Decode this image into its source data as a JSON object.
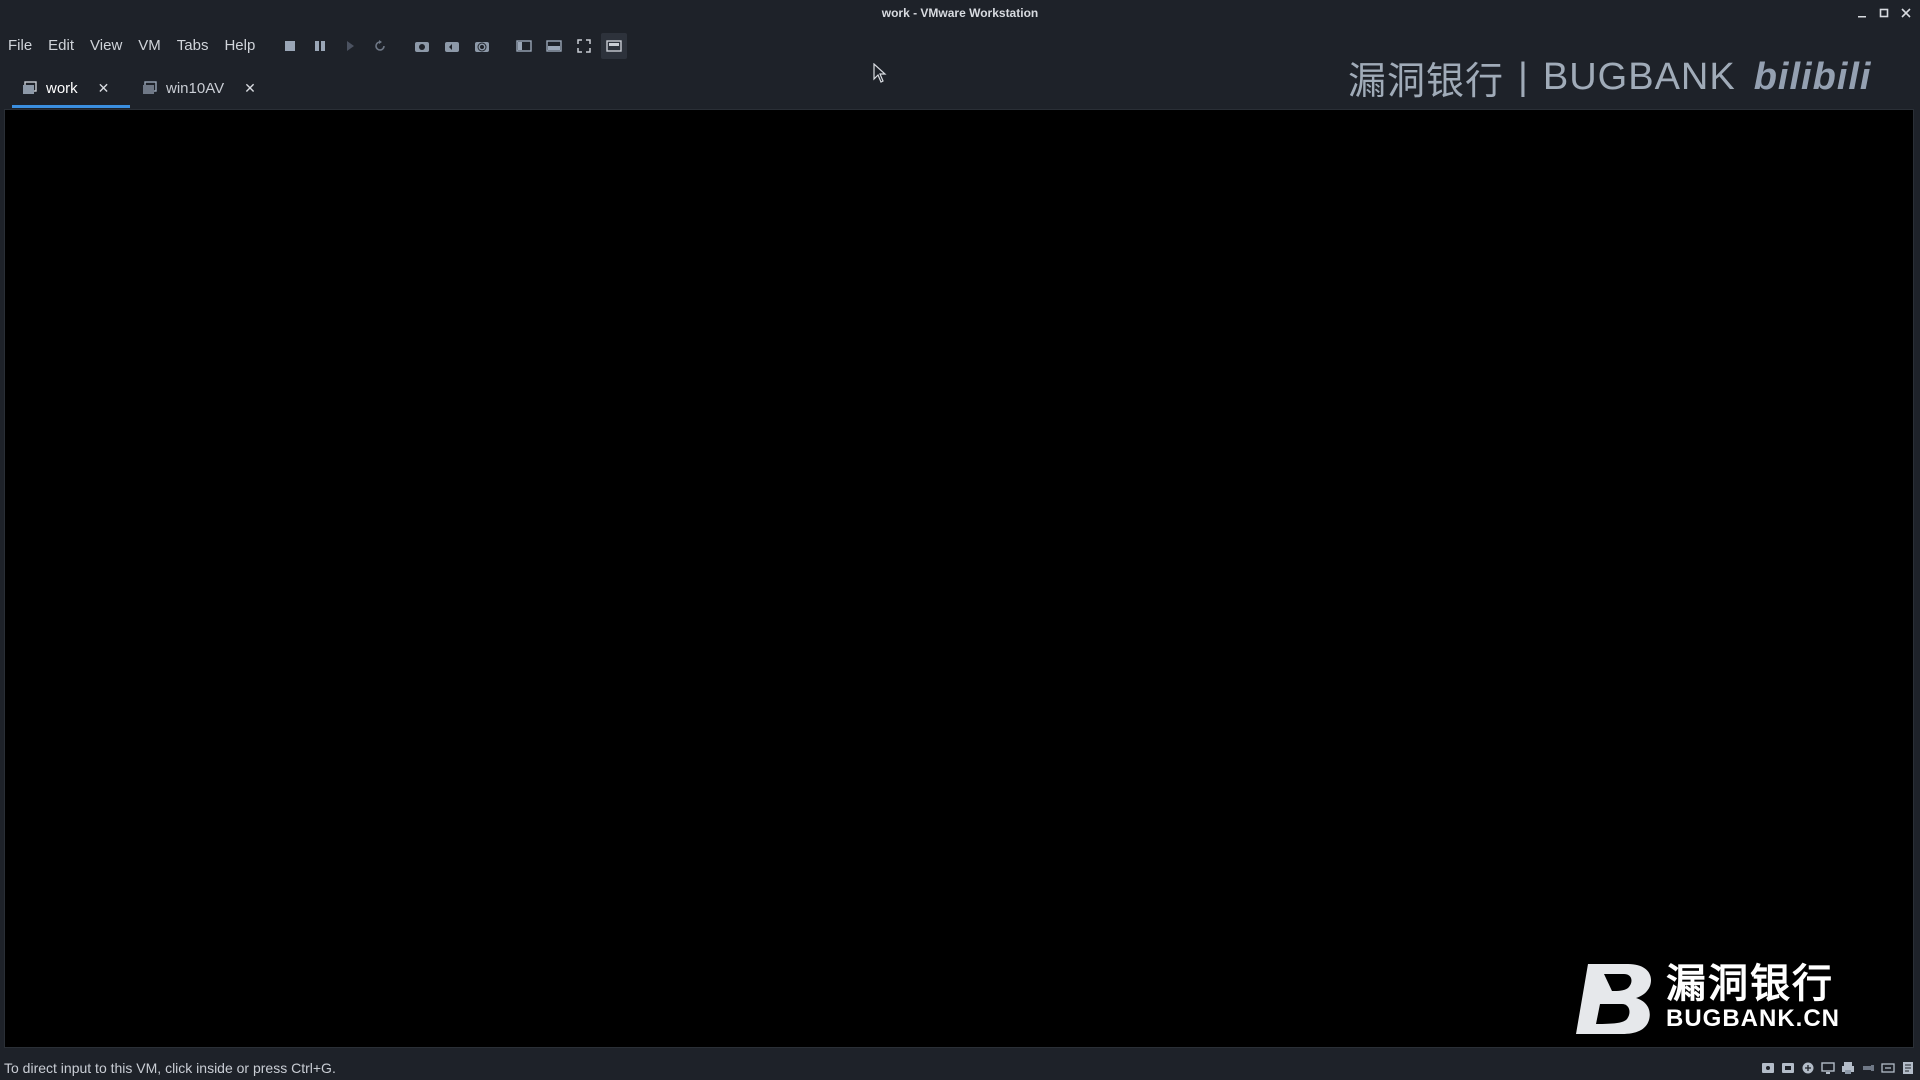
{
  "window": {
    "title": "work - VMware Workstation",
    "controls": [
      "minimize",
      "maximize",
      "close"
    ]
  },
  "menu": {
    "items": [
      "File",
      "Edit",
      "View",
      "VM",
      "Tabs",
      "Help"
    ]
  },
  "toolbar": {
    "buttons": [
      "power-off-icon",
      "suspend-icon",
      "play-icon",
      "restart-icon",
      "snapshot-icon",
      "revert-snapshot-icon",
      "snapshot-manager-icon",
      "library-view-icon",
      "console-view-icon",
      "fullscreen-icon",
      "unity-icon"
    ]
  },
  "tabs": [
    {
      "label": "work",
      "active": true,
      "close": "✕"
    },
    {
      "label": "win10AV",
      "active": false,
      "close": "✕"
    }
  ],
  "watermarks": {
    "top_cn": "漏洞银行",
    "top_sep": "|",
    "top_en": "BUGBANK",
    "top_site": "bilibili",
    "bottom_cn": "漏洞银行",
    "bottom_en": "BUGBANK.CN"
  },
  "status": {
    "message": "To direct input to this VM, click inside or press Ctrl+G.",
    "device_icons": [
      "hdd-icon",
      "cd-icon",
      "network-icon",
      "display-icon",
      "printer-icon",
      "usb-icon",
      "sound-icon",
      "message-icon"
    ]
  },
  "colors": {
    "background": "#1e2229",
    "vm_screen": "#000000",
    "accent": "#3b8fe0"
  }
}
